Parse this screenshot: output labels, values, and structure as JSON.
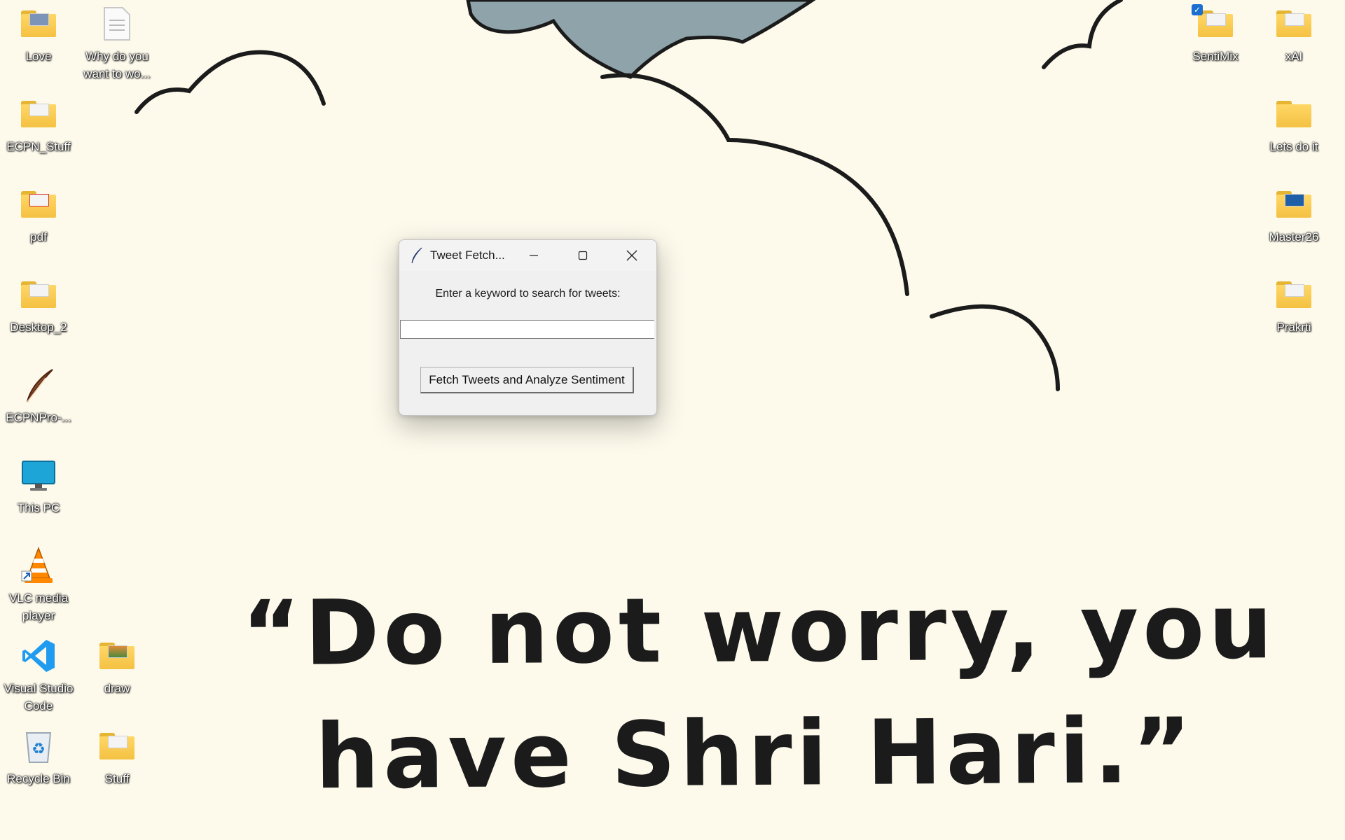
{
  "wallpaper": {
    "quote_line1": "“Do not worry, you",
    "quote_line2": "have Shri Hari.”",
    "background_color": "#fdfaec",
    "cloud_fill": "#8fa4aa"
  },
  "desktop_icons_left": [
    {
      "label": "Love",
      "icon": "folder-photo-icon"
    },
    {
      "label": "Why do you want to wo...",
      "icon": "text-document-icon"
    },
    {
      "label": "ECPN_Stuff",
      "icon": "folder-icon"
    },
    {
      "label": "pdf",
      "icon": "folder-pdf-icon"
    },
    {
      "label": "Desktop_2",
      "icon": "folder-icon"
    },
    {
      "label": "ECPNPro-...",
      "icon": "feather-icon"
    },
    {
      "label": "This PC",
      "icon": "monitor-icon"
    },
    {
      "label": "VLC media player",
      "icon": "vlc-cone-icon"
    },
    {
      "label": "Visual Studio Code",
      "icon": "vscode-icon"
    },
    {
      "label": "draw",
      "icon": "folder-image-icon"
    },
    {
      "label": "Recycle Bin",
      "icon": "recycle-bin-icon"
    },
    {
      "label": "Stuff",
      "icon": "folder-icon"
    }
  ],
  "desktop_icons_right": [
    {
      "label": "SentiMix",
      "icon": "folder-checked-icon"
    },
    {
      "label": "xAI",
      "icon": "folder-icon"
    },
    {
      "label": "Lets do it",
      "icon": "folder-icon"
    },
    {
      "label": "Master26",
      "icon": "folder-shortcut-icon"
    },
    {
      "label": "Prakrti",
      "icon": "folder-icon"
    }
  ],
  "window": {
    "title": "Tweet Fetch...",
    "prompt": "Enter a keyword to search for tweets:",
    "input_value": "",
    "button_label": "Fetch Tweets and Analyze Sentiment"
  }
}
